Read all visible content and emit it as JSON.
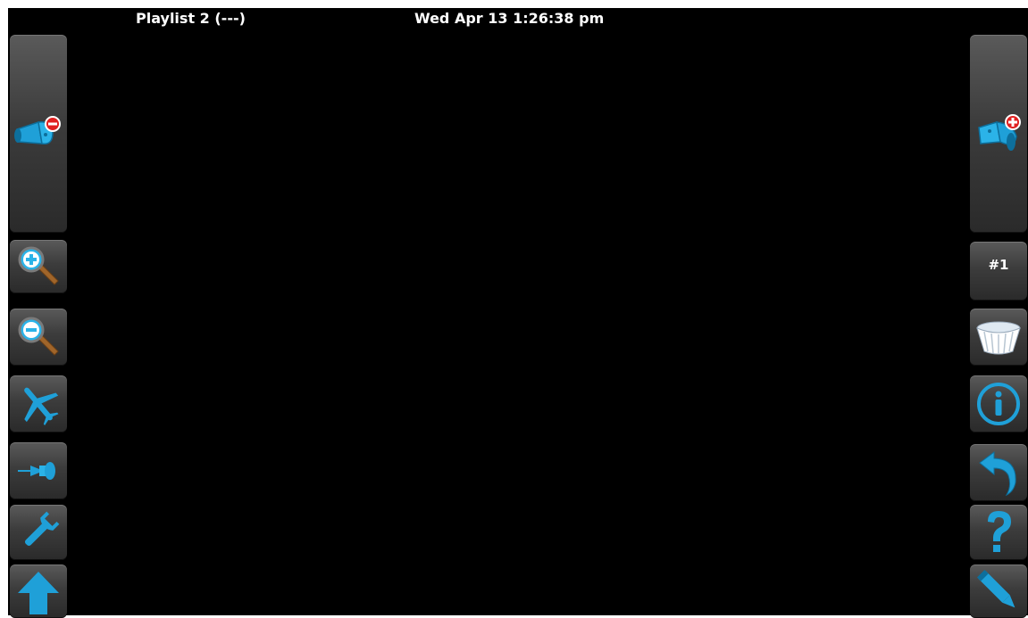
{
  "header": {
    "playlist_label": "Playlist 2 (---)",
    "datetime": "Wed Apr 13 1:26:38 pm"
  },
  "left_toolbar": {
    "items": [
      {
        "icon": "spotlight-remove-icon"
      },
      {
        "icon": "zoom-in-icon"
      },
      {
        "icon": "zoom-out-icon"
      },
      {
        "icon": "airplane-icon"
      },
      {
        "icon": "pushpin-icon"
      },
      {
        "icon": "wrench-icon"
      },
      {
        "icon": "arrow-up-icon"
      }
    ]
  },
  "right_toolbar": {
    "items": [
      {
        "icon": "spotlight-add-icon"
      },
      {
        "label": "#1"
      },
      {
        "icon": "cupcake-liner-icon"
      },
      {
        "icon": "info-icon"
      },
      {
        "icon": "undo-arrow-icon"
      },
      {
        "icon": "question-mark-icon"
      },
      {
        "icon": "pencil-icon"
      }
    ]
  },
  "colors": {
    "icon_blue": "#1fa0d8",
    "background": "#000000",
    "button": "#3c3c3c"
  }
}
